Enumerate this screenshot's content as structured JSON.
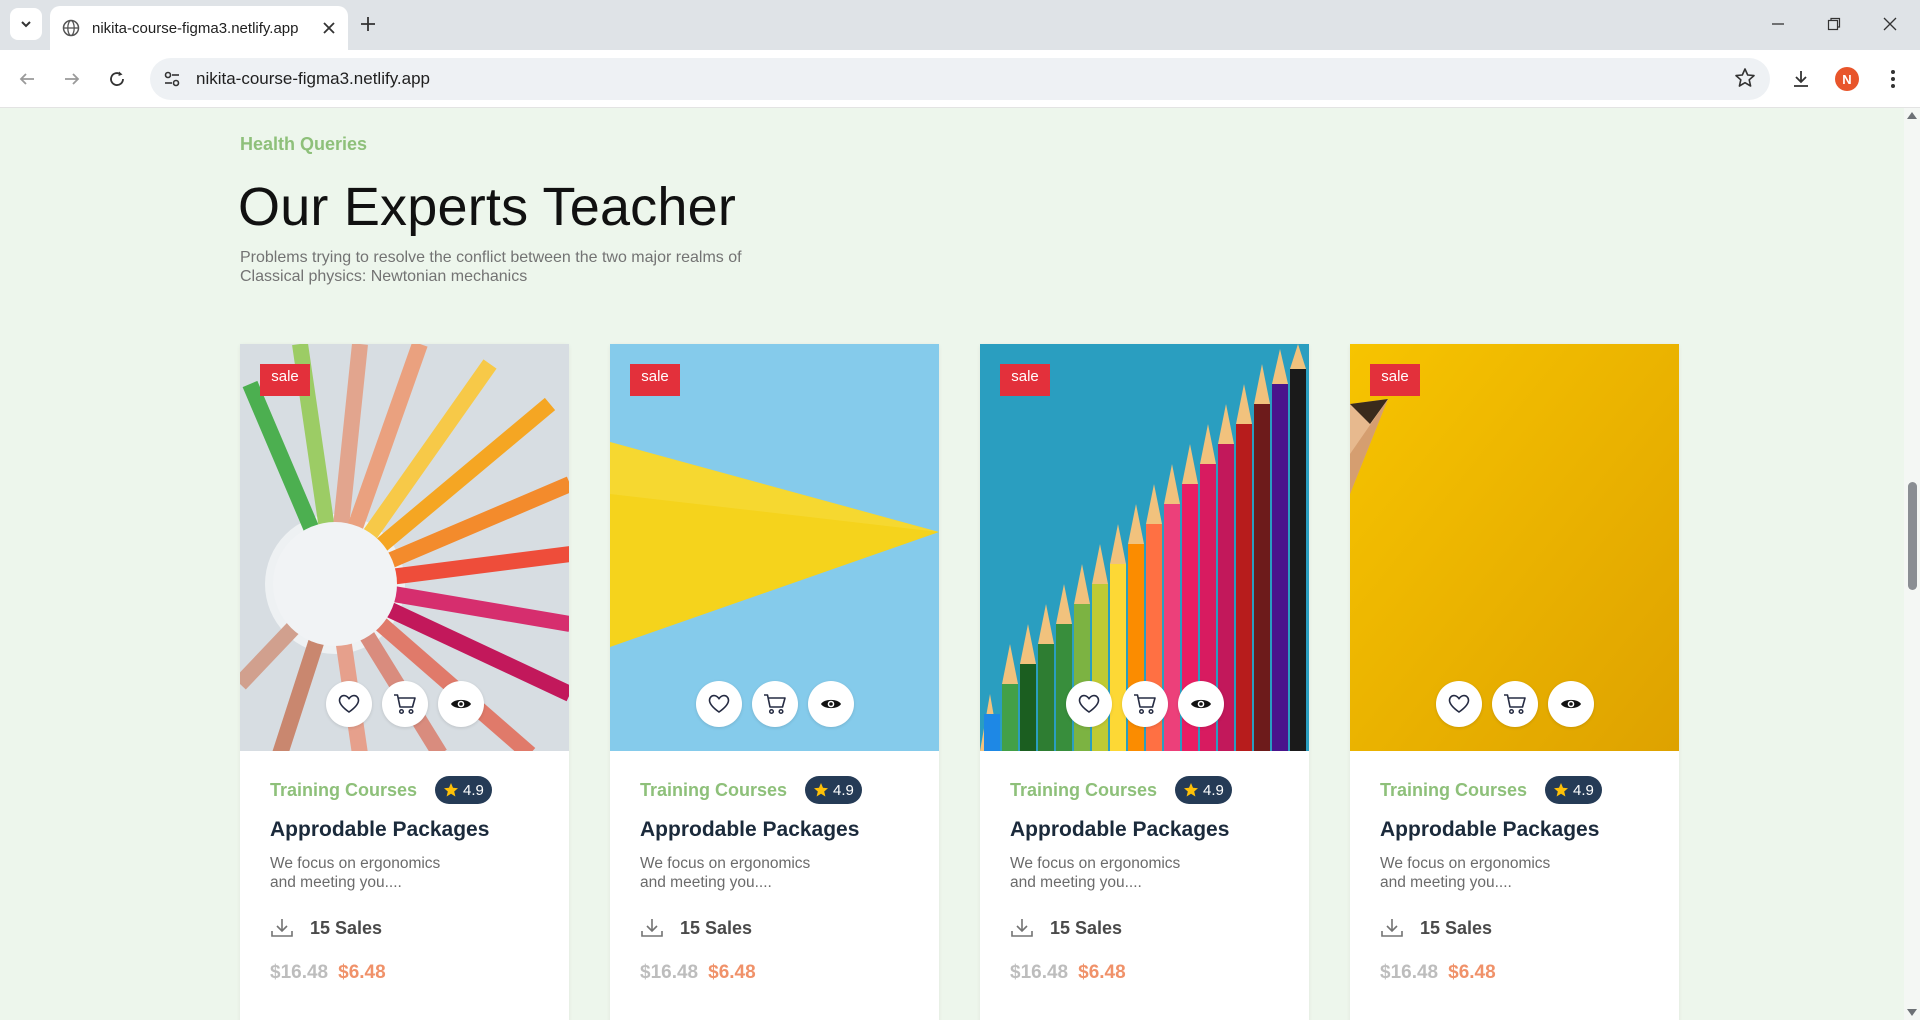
{
  "browser": {
    "tab_title": "nikita-course-figma3.netlify.app",
    "url": "nikita-course-figma3.netlify.app",
    "profile_initial": "N",
    "profile_color": "#e8552b"
  },
  "section": {
    "eyebrow": "Health Queries",
    "heading": "Our Experts Teacher",
    "subtext_line1": "Problems trying to resolve the conflict between the two major realms of",
    "subtext_line2": "Classical physics: Newtonian mechanics"
  },
  "colors": {
    "accent_green": "#8ec07a",
    "sale_red": "#e3303b",
    "rating_navy": "#253b56",
    "price_orange": "#f0926a",
    "page_bg": "#edf6ec"
  },
  "cards": [
    {
      "image": "pencil-circle-image",
      "sale_label": "sale",
      "category": "Training Courses",
      "rating": "4.9",
      "title": "Approdable Packages",
      "desc_line1": "We focus on ergonomics",
      "desc_line2": "and meeting you....",
      "sales": "15 Sales",
      "old_price": "$16.48",
      "new_price": "$6.48"
    },
    {
      "image": "blue-yellow-paper-image",
      "sale_label": "sale",
      "category": "Training Courses",
      "rating": "4.9",
      "title": "Approdable Packages",
      "desc_line1": "We focus on ergonomics",
      "desc_line2": "and meeting you....",
      "sales": "15 Sales",
      "old_price": "$16.48",
      "new_price": "$6.48"
    },
    {
      "image": "colored-pencils-rising-image",
      "sale_label": "sale",
      "category": "Training Courses",
      "rating": "4.9",
      "title": "Approdable Packages",
      "desc_line1": "We focus on ergonomics",
      "desc_line2": "and meeting you....",
      "sales": "15 Sales",
      "old_price": "$16.48",
      "new_price": "$6.48"
    },
    {
      "image": "yellow-pencil-image",
      "sale_label": "sale",
      "category": "Training Courses",
      "rating": "4.9",
      "title": "Approdable Packages",
      "desc_line1": "We focus on ergonomics",
      "desc_line2": "and meeting you....",
      "sales": "15 Sales",
      "old_price": "$16.48",
      "new_price": "$6.48"
    }
  ]
}
